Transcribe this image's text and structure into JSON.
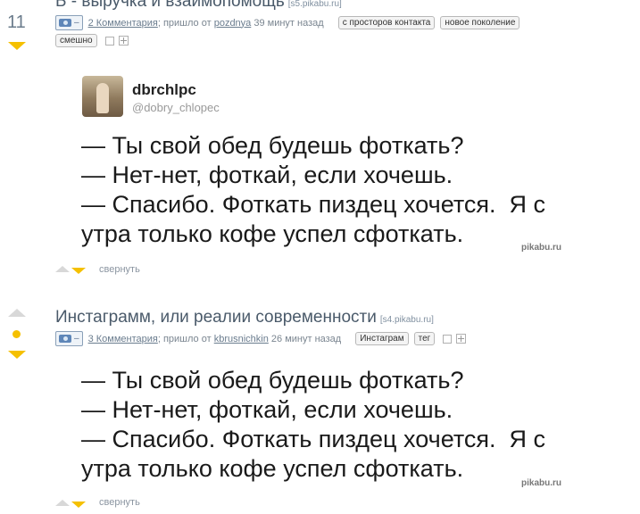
{
  "post1": {
    "rating": "11",
    "title": "Б - выручка и взаимопомощь",
    "source": "[s5.pikabu.ru]",
    "comments": "2 Комментария",
    "came_from_prefix": "; пришло от",
    "author": "pozdnya",
    "time": "39 минут назад",
    "tags": [
      "с просторов контакта",
      "новое поколение",
      "смешно"
    ],
    "tweet_user": "dbrchlpc",
    "tweet_handle": "@dobry_chlopec",
    "text": "— Ты свой обед будешь фоткать?\n— Нет-нет, фоткай, если хочешь.\n— Спасибо. Фоткать пиздец хочется.  Я с\nутра только кофе успел сфоткать.",
    "watermark": "pikabu.ru",
    "collapse": "свернуть"
  },
  "post2": {
    "title": "Инстаграмм, или реалии современности",
    "source": "[s4.pikabu.ru]",
    "comments": "3 Комментария",
    "came_from_prefix": "; пришло от",
    "author": "kbrusnichkin",
    "time": "26 минут назад",
    "tags": [
      "Инстаграм",
      "тег"
    ],
    "text": "— Ты свой обед будешь фоткать?\n— Нет-нет, фоткай, если хочешь.\n— Спасибо. Фоткать пиздец хочется.  Я с\nутра только кофе успел сфоткать.",
    "watermark": "pikabu.ru",
    "collapse": "свернуть"
  },
  "icons": {
    "camera": "camera-icon",
    "minus": "–",
    "save": "save-icon",
    "add": "add-icon"
  },
  "colors": {
    "accent_yellow": "#f5c000",
    "link": "#6a7c8e"
  }
}
